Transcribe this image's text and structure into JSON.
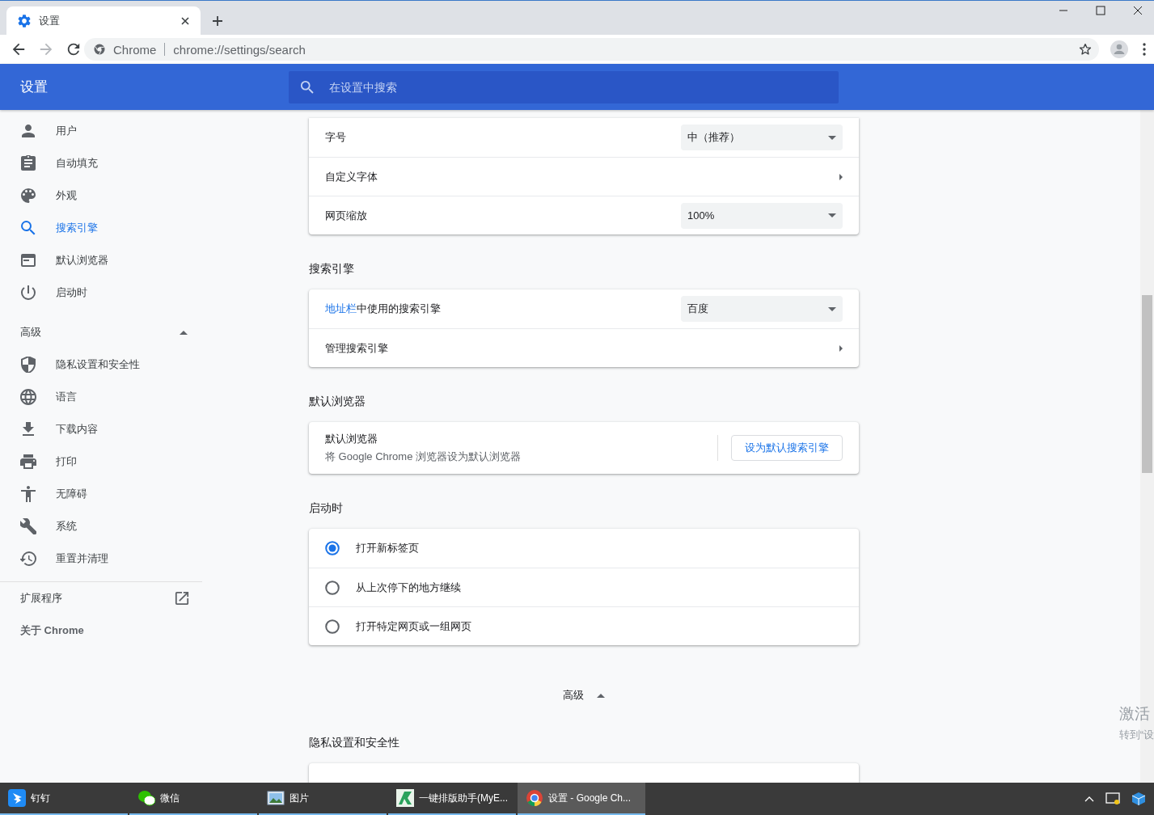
{
  "browser": {
    "tab": {
      "title": "设置",
      "selected": true
    },
    "address": {
      "site": "Chrome",
      "url": "chrome://settings/search"
    }
  },
  "header": {
    "title": "设置",
    "search": {
      "placeholder": "在设置中搜索"
    }
  },
  "sidebar": {
    "items": [
      {
        "label": "用户",
        "selected": false
      },
      {
        "label": "自动填充",
        "selected": false
      },
      {
        "label": "外观",
        "selected": false
      },
      {
        "label": "搜索引擎",
        "selected": true
      },
      {
        "label": "默认浏览器",
        "selected": false
      },
      {
        "label": "启动时",
        "selected": false
      }
    ],
    "advanced": {
      "label": "高级",
      "expanded": true,
      "items": [
        {
          "label": "隐私设置和安全性",
          "selected": false
        },
        {
          "label": "语言",
          "selected": false
        },
        {
          "label": "下载内容",
          "selected": false
        },
        {
          "label": "打印",
          "selected": false
        },
        {
          "label": "无障碍",
          "selected": false
        },
        {
          "label": "系统",
          "selected": false
        },
        {
          "label": "重置并清理",
          "selected": false
        }
      ]
    },
    "extensions": "扩展程序",
    "about": "关于 Chrome"
  },
  "sections": [
    {
      "rows": [
        {
          "kind": "dropdown",
          "label": "字号",
          "value": "中（推荐）"
        },
        {
          "kind": "submenu",
          "label": "自定义字体"
        },
        {
          "kind": "dropdown",
          "label": "网页缩放",
          "value": "100%"
        }
      ]
    },
    {
      "title": "搜索引擎",
      "rows": [
        {
          "kind": "dropdown",
          "link": "地址栏",
          "label": "中使用的搜索引擎",
          "value": "百度"
        },
        {
          "kind": "submenu",
          "label": "管理搜索引擎"
        }
      ]
    },
    {
      "title": "默认浏览器",
      "rows": [
        {
          "kind": "button",
          "label": "默认浏览器",
          "sublabel": "将 Google Chrome 浏览器设为默认浏览器",
          "button": "设为默认搜索引擎"
        }
      ]
    },
    {
      "title": "启动时",
      "rows": [
        {
          "kind": "radio",
          "label": "打开新标签页",
          "selected": true
        },
        {
          "kind": "radio",
          "label": "从上次停下的地方继续",
          "selected": false
        },
        {
          "kind": "radio",
          "label": "打开特定网页或一组网页",
          "selected": false
        }
      ]
    },
    {
      "toggle": {
        "label": "高级",
        "expanded": true
      }
    },
    {
      "title": "隐私设置和安全性"
    }
  ],
  "activation": {
    "title": "激活",
    "hint": "转到“设"
  },
  "taskbar": {
    "items": [
      {
        "label": "钉钉",
        "selected": false
      },
      {
        "label": "微信",
        "selected": false
      },
      {
        "label": "图片",
        "selected": false
      },
      {
        "label": "一键排版助手(MyE...",
        "selected": false
      },
      {
        "label": "设置 - Google Ch...",
        "selected": true
      }
    ]
  }
}
